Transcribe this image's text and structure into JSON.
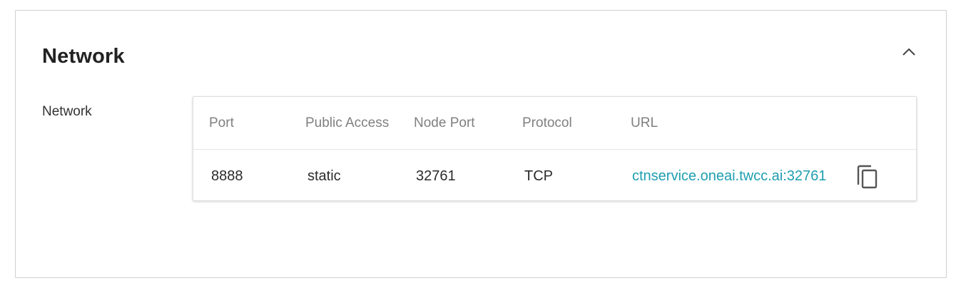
{
  "section": {
    "title": "Network",
    "collapse_icon": "chevron-up-icon"
  },
  "field": {
    "label": "Network"
  },
  "table": {
    "headers": {
      "port": "Port",
      "public_access": "Public Access",
      "node_port": "Node Port",
      "protocol": "Protocol",
      "url": "URL"
    },
    "rows": [
      {
        "port": "8888",
        "public_access": "static",
        "node_port": "32761",
        "protocol": "TCP",
        "url": "ctnservice.oneai.twcc.ai:32761",
        "copy_icon": "copy-icon"
      }
    ]
  },
  "colors": {
    "link": "#1e9eb0",
    "header_text": "#808080",
    "title_text": "#222222"
  }
}
